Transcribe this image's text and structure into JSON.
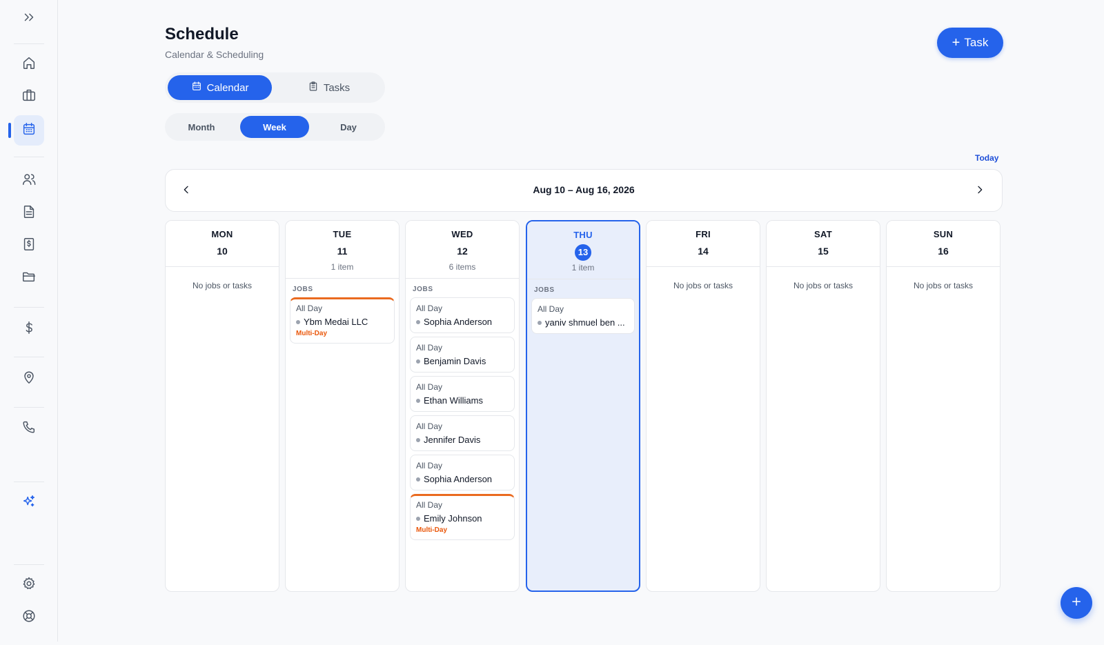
{
  "sidebar": {
    "items": [
      {
        "name": "expand-icon"
      },
      {
        "name": "home-icon"
      },
      {
        "name": "briefcase-icon"
      },
      {
        "name": "calendar-icon",
        "active": true
      },
      {
        "name": "users-icon"
      },
      {
        "name": "document-icon"
      },
      {
        "name": "invoice-icon"
      },
      {
        "name": "folder-icon"
      },
      {
        "name": "dollar-icon"
      },
      {
        "name": "map-pin-icon"
      },
      {
        "name": "phone-icon"
      },
      {
        "name": "sparkles-icon"
      },
      {
        "name": "gear-icon"
      },
      {
        "name": "help-icon"
      }
    ]
  },
  "header": {
    "title": "Schedule",
    "subtitle": "Calendar & Scheduling",
    "task_button": "Task"
  },
  "view_tabs": {
    "calendar": "Calendar",
    "tasks": "Tasks",
    "selected": "Calendar"
  },
  "range_tabs": {
    "month": "Month",
    "week": "Week",
    "day": "Day",
    "selected": "Week"
  },
  "today_label": "Today",
  "date_range": "Aug 10 – Aug 16, 2026",
  "colors": {
    "accent": "#2563eb",
    "multi_day": "#ea580c",
    "today_bg": "#e8eefb"
  },
  "days": [
    {
      "dow": "MON",
      "num": "10",
      "count": "",
      "empty_text": "No jobs or tasks"
    },
    {
      "dow": "TUE",
      "num": "11",
      "count": "1 item",
      "section": "JOBS",
      "cards": [
        {
          "time": "All Day",
          "name": "Ybm Medai LLC",
          "tag": "Multi-Day"
        }
      ]
    },
    {
      "dow": "WED",
      "num": "12",
      "count": "6 items",
      "section": "JOBS",
      "cards": [
        {
          "time": "All Day",
          "name": "Sophia Anderson"
        },
        {
          "time": "All Day",
          "name": "Benjamin Davis"
        },
        {
          "time": "All Day",
          "name": "Ethan Williams"
        },
        {
          "time": "All Day",
          "name": "Jennifer Davis"
        },
        {
          "time": "All Day",
          "name": "Sophia Anderson"
        },
        {
          "time": "All Day",
          "name": "Emily Johnson",
          "tag": "Multi-Day"
        }
      ]
    },
    {
      "dow": "THU",
      "num": "13",
      "count": "1 item",
      "section": "JOBS",
      "today": true,
      "cards": [
        {
          "time": "All Day",
          "name": "yaniv shmuel ben ..."
        }
      ]
    },
    {
      "dow": "FRI",
      "num": "14",
      "count": "",
      "empty_text": "No jobs or tasks"
    },
    {
      "dow": "SAT",
      "num": "15",
      "count": "",
      "empty_text": "No jobs or tasks"
    },
    {
      "dow": "SUN",
      "num": "16",
      "count": "",
      "empty_text": "No jobs or tasks"
    }
  ]
}
